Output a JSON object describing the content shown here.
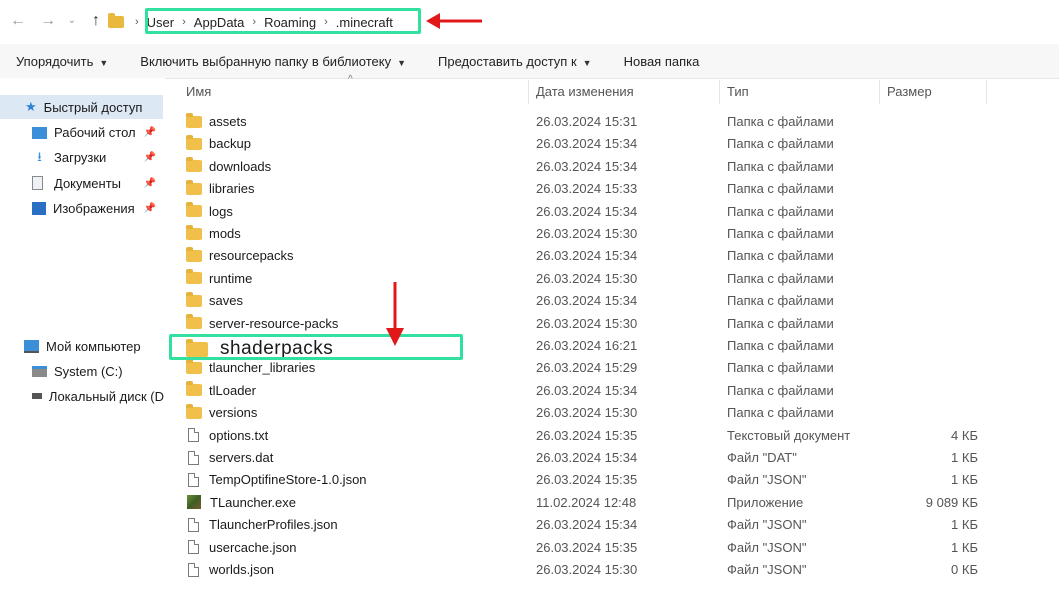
{
  "address": {
    "crumbs": [
      "User",
      "AppData",
      "Roaming",
      ".minecraft"
    ]
  },
  "toolbar": {
    "items": [
      "Упорядочить",
      "Включить выбранную папку в библиотеку",
      "Предоставить доступ к",
      "Новая папка"
    ]
  },
  "nav": {
    "quick_access": "Быстрый доступ",
    "desktop": "Рабочий стол",
    "downloads": "Загрузки",
    "documents": "Документы",
    "pictures": "Изображения",
    "computer": "Мой компьютер",
    "system_drive": "System (C:)",
    "local_drive": "Локальный диск (D"
  },
  "columns": {
    "name": "Имя",
    "date": "Дата изменения",
    "type": "Тип",
    "size": "Размер"
  },
  "rows": [
    {
      "name": "assets",
      "date": "26.03.2024 15:31",
      "type": "Папка с файлами",
      "size": "",
      "icon": "folder-icon"
    },
    {
      "name": "backup",
      "date": "26.03.2024 15:34",
      "type": "Папка с файлами",
      "size": "",
      "icon": "folder-icon"
    },
    {
      "name": "downloads",
      "date": "26.03.2024 15:34",
      "type": "Папка с файлами",
      "size": "",
      "icon": "folder-icon"
    },
    {
      "name": "libraries",
      "date": "26.03.2024 15:33",
      "type": "Папка с файлами",
      "size": "",
      "icon": "folder-icon"
    },
    {
      "name": "logs",
      "date": "26.03.2024 15:34",
      "type": "Папка с файлами",
      "size": "",
      "icon": "folder-icon"
    },
    {
      "name": "mods",
      "date": "26.03.2024 15:30",
      "type": "Папка с файлами",
      "size": "",
      "icon": "folder-icon"
    },
    {
      "name": "resourcepacks",
      "date": "26.03.2024 15:34",
      "type": "Папка с файлами",
      "size": "",
      "icon": "folder-icon"
    },
    {
      "name": "runtime",
      "date": "26.03.2024 15:30",
      "type": "Папка с файлами",
      "size": "",
      "icon": "folder-icon"
    },
    {
      "name": "saves",
      "date": "26.03.2024 15:34",
      "type": "Папка с файлами",
      "size": "",
      "icon": "folder-icon"
    },
    {
      "name": "server-resource-packs",
      "date": "26.03.2024 15:30",
      "type": "Папка с файлами",
      "size": "",
      "icon": "folder-icon"
    },
    {
      "name": "shaderpacks",
      "date": "26.03.2024 16:21",
      "type": "Папка с файлами",
      "size": "",
      "icon": "folder-icon"
    },
    {
      "name": "tlauncher_libraries",
      "date": "26.03.2024 15:29",
      "type": "Папка с файлами",
      "size": "",
      "icon": "folder-icon"
    },
    {
      "name": "tlLoader",
      "date": "26.03.2024 15:34",
      "type": "Папка с файлами",
      "size": "",
      "icon": "folder-icon"
    },
    {
      "name": "versions",
      "date": "26.03.2024 15:30",
      "type": "Папка с файлами",
      "size": "",
      "icon": "folder-icon"
    },
    {
      "name": "options.txt",
      "date": "26.03.2024 15:35",
      "type": "Текстовый документ",
      "size": "4 КБ",
      "icon": "document-icon"
    },
    {
      "name": "servers.dat",
      "date": "26.03.2024 15:34",
      "type": "Файл \"DAT\"",
      "size": "1 КБ",
      "icon": "document-icon"
    },
    {
      "name": "TempOptifineStore-1.0.json",
      "date": "26.03.2024 15:35",
      "type": "Файл \"JSON\"",
      "size": "1 КБ",
      "icon": "document-icon"
    },
    {
      "name": "TLauncher.exe",
      "date": "11.02.2024 12:48",
      "type": "Приложение",
      "size": "9 089 КБ",
      "icon": "application-icon"
    },
    {
      "name": "TlauncherProfiles.json",
      "date": "26.03.2024 15:34",
      "type": "Файл \"JSON\"",
      "size": "1 КБ",
      "icon": "document-icon"
    },
    {
      "name": "usercache.json",
      "date": "26.03.2024 15:35",
      "type": "Файл \"JSON\"",
      "size": "1 КБ",
      "icon": "document-icon"
    },
    {
      "name": "worlds.json",
      "date": "26.03.2024 15:30",
      "type": "Файл \"JSON\"",
      "size": "0 КБ",
      "icon": "document-icon"
    }
  ],
  "colors": {
    "highlight": "#32e0a0",
    "arrow": "#e01818",
    "folder": "#f0c04a",
    "selection": "#dde8f5"
  }
}
